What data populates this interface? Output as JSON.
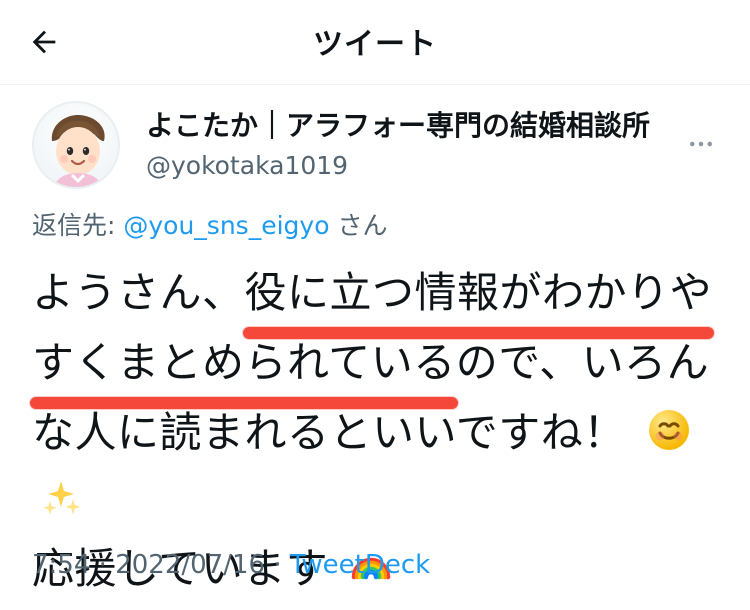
{
  "header": {
    "title": "ツイート",
    "back_icon": "arrow-left-icon"
  },
  "author": {
    "display_name": "よこたか｜アラフォー専門の結婚相談所",
    "handle": "@yokotaka1019",
    "more_icon": "more-horizontal-icon"
  },
  "reply_to": {
    "prefix": "返信先: ",
    "mention": "@you_sns_eigyo",
    "suffix": "さん"
  },
  "tweet": {
    "lines": [
      {
        "a": "ようさん、",
        "hl": "役に立つ情報がわかりや",
        "b": ""
      },
      {
        "a": "",
        "hl": "すくまとめられている",
        "b": "ので、いろん"
      },
      {
        "a": "な人に読まれるといいですね！",
        "hl": "",
        "b": ""
      },
      {
        "a": "応援しています",
        "hl": "",
        "b": ""
      }
    ],
    "emoji": {
      "smile": "smile-emoji",
      "sparkles": "sparkles-emoji",
      "rainbow": "rainbow-emoji"
    }
  },
  "footer": {
    "time": "7:54",
    "date": "2022/07/16",
    "source": "TweetDeck"
  }
}
